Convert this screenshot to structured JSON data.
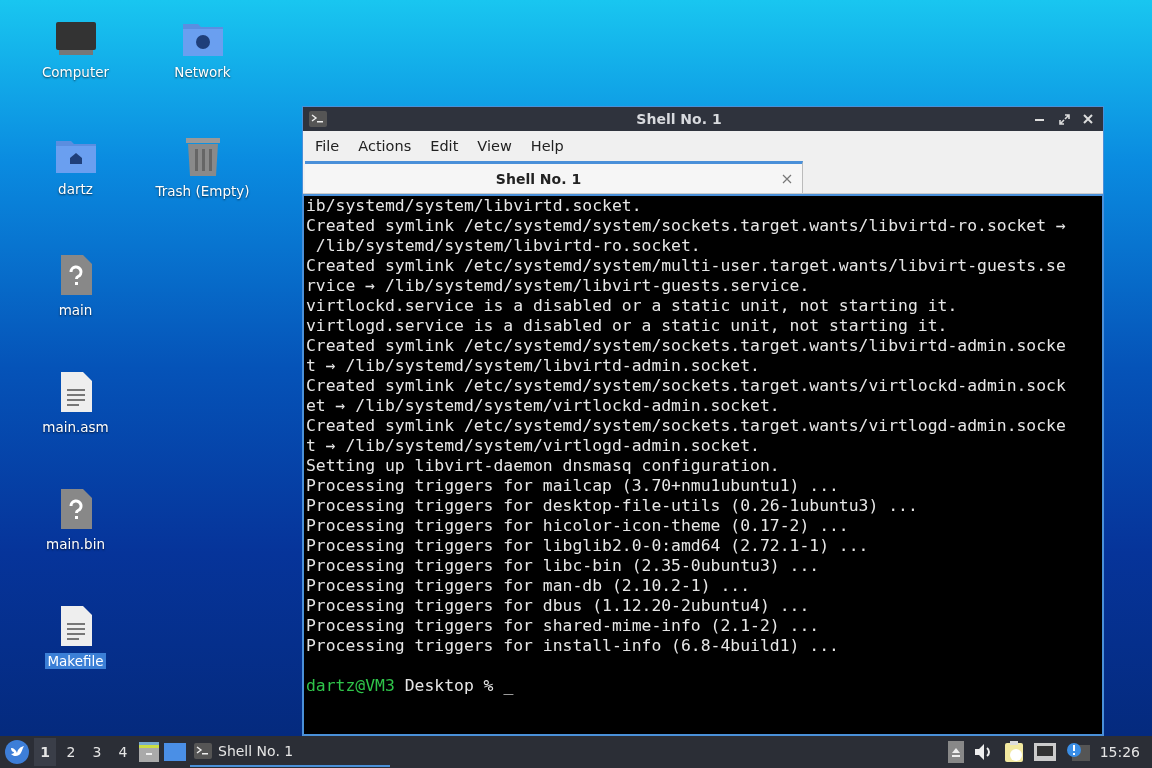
{
  "desktop_icons": [
    {
      "label": "Computer",
      "kind": "computer",
      "selected": false
    },
    {
      "label": "Network",
      "kind": "network",
      "selected": false
    },
    {
      "label": "dartz",
      "kind": "home",
      "selected": false
    },
    {
      "label": "Trash (Empty)",
      "kind": "trash",
      "selected": false
    },
    {
      "label": "main",
      "kind": "unknown",
      "selected": false
    },
    {
      "label": "main.asm",
      "kind": "text",
      "selected": false
    },
    {
      "label": "main.bin",
      "kind": "unknown",
      "selected": false
    },
    {
      "label": "Makefile",
      "kind": "text",
      "selected": true
    }
  ],
  "window": {
    "title": "Shell No. 1",
    "menu": [
      "File",
      "Actions",
      "Edit",
      "View",
      "Help"
    ],
    "tabs": [
      {
        "label": "Shell No. 1",
        "selected": true
      }
    ],
    "terminal": {
      "lines": [
        {
          "kind": "output",
          "text": "ib/systemd/system/libvirtd.socket."
        },
        {
          "kind": "output",
          "text": "Created symlink /etc/systemd/system/sockets.target.wants/libvirtd-ro.socket →"
        },
        {
          "kind": "output",
          "text": " /lib/systemd/system/libvirtd-ro.socket."
        },
        {
          "kind": "output",
          "text": "Created symlink /etc/systemd/system/multi-user.target.wants/libvirt-guests.se"
        },
        {
          "kind": "output",
          "text": "rvice → /lib/systemd/system/libvirt-guests.service."
        },
        {
          "kind": "output",
          "text": "virtlockd.service is a disabled or a static unit, not starting it."
        },
        {
          "kind": "output",
          "text": "virtlogd.service is a disabled or a static unit, not starting it."
        },
        {
          "kind": "output",
          "text": "Created symlink /etc/systemd/system/sockets.target.wants/libvirtd-admin.socke"
        },
        {
          "kind": "output",
          "text": "t → /lib/systemd/system/libvirtd-admin.socket."
        },
        {
          "kind": "output",
          "text": "Created symlink /etc/systemd/system/sockets.target.wants/virtlockd-admin.sock"
        },
        {
          "kind": "output",
          "text": "et → /lib/systemd/system/virtlockd-admin.socket."
        },
        {
          "kind": "output",
          "text": "Created symlink /etc/systemd/system/sockets.target.wants/virtlogd-admin.socke"
        },
        {
          "kind": "output",
          "text": "t → /lib/systemd/system/virtlogd-admin.socket."
        },
        {
          "kind": "output",
          "text": "Setting up libvirt-daemon dnsmasq configuration."
        },
        {
          "kind": "output",
          "text": "Processing triggers for mailcap (3.70+nmu1ubuntu1) ..."
        },
        {
          "kind": "output",
          "text": "Processing triggers for desktop-file-utils (0.26-1ubuntu3) ..."
        },
        {
          "kind": "output",
          "text": "Processing triggers for hicolor-icon-theme (0.17-2) ..."
        },
        {
          "kind": "output",
          "text": "Processing triggers for libglib2.0-0:amd64 (2.72.1-1) ..."
        },
        {
          "kind": "output",
          "text": "Processing triggers for libc-bin (2.35-0ubuntu3) ..."
        },
        {
          "kind": "output",
          "text": "Processing triggers for man-db (2.10.2-1) ..."
        },
        {
          "kind": "output",
          "text": "Processing triggers for dbus (1.12.20-2ubuntu4) ..."
        },
        {
          "kind": "output",
          "text": "Processing triggers for shared-mime-info (2.1-2) ..."
        },
        {
          "kind": "output",
          "text": "Processing triggers for install-info (6.8-4build1) ..."
        },
        {
          "kind": "blank"
        },
        {
          "kind": "prompt",
          "user_host": "dartz@VM3",
          "text": " Desktop % ",
          "cursor": "_"
        }
      ]
    }
  },
  "taskbar": {
    "workspaces": [
      {
        "label": "1",
        "selected": true
      },
      {
        "label": "2",
        "selected": false
      },
      {
        "label": "3",
        "selected": false
      },
      {
        "label": "4",
        "selected": false
      }
    ],
    "tasks": [
      {
        "label": "Shell No. 1",
        "selected": true
      }
    ],
    "clock": "15:26"
  }
}
